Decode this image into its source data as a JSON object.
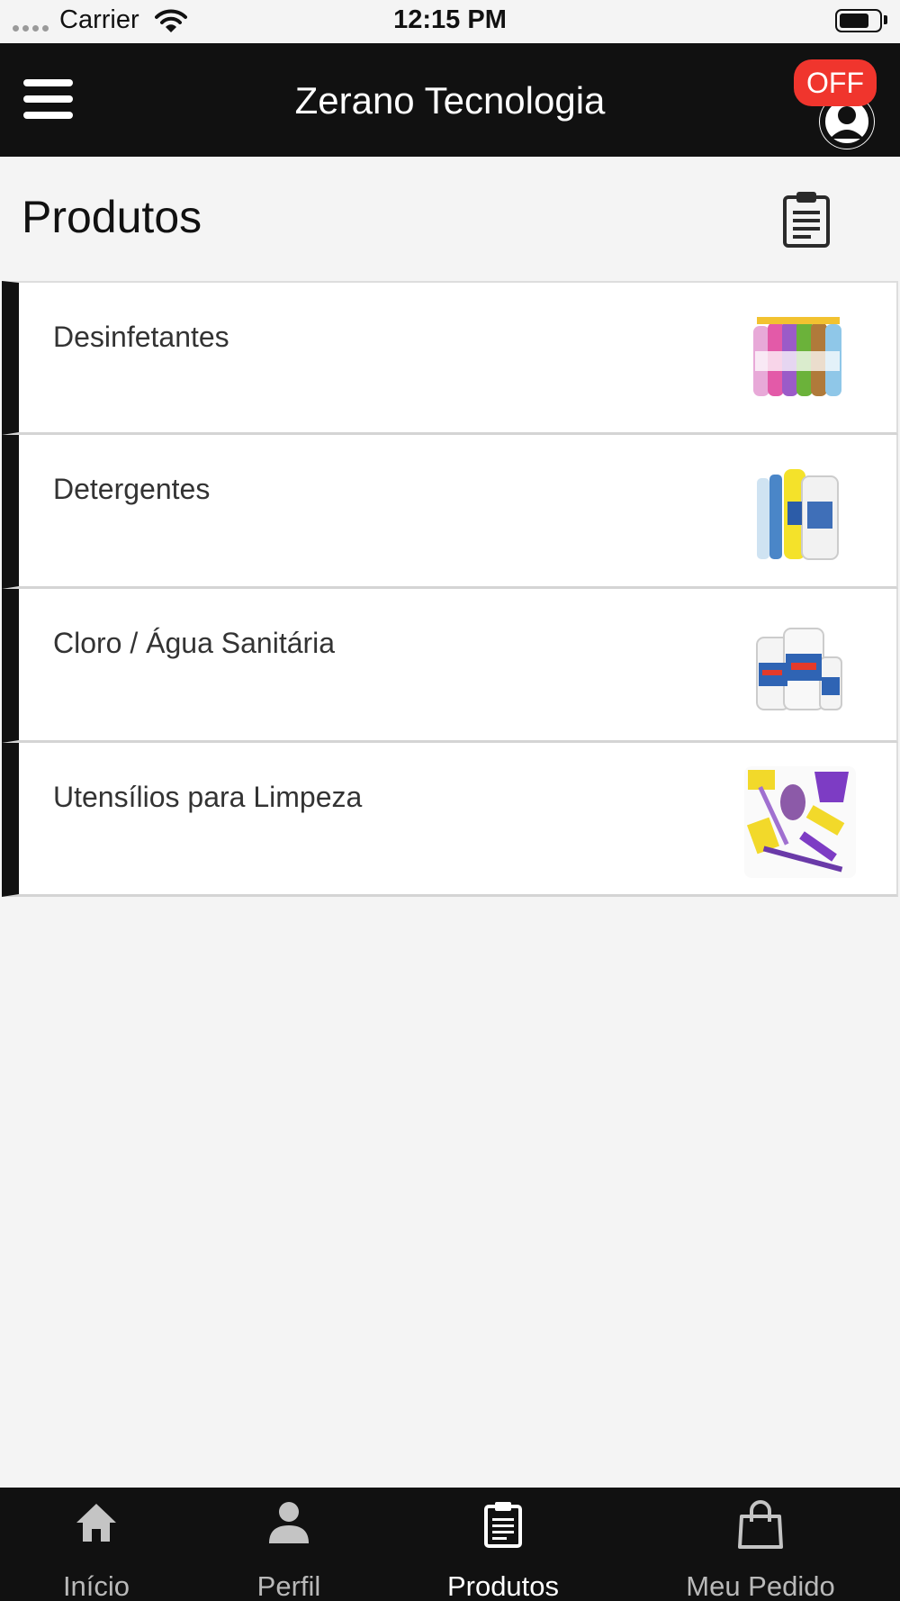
{
  "status_bar": {
    "carrier": "Carrier",
    "time": "12:15 PM"
  },
  "header": {
    "title": "Zerano Tecnologia",
    "status_badge": "OFF"
  },
  "page": {
    "title": "Produtos"
  },
  "categories": [
    {
      "label": "Desinfetantes",
      "image": "disinfectant-bottles"
    },
    {
      "label": "Detergentes",
      "image": "detergent-bottles"
    },
    {
      "label": "Cloro / Água Sanitária",
      "image": "bleach-bottles"
    },
    {
      "label": "Utensílios para Limpeza",
      "image": "cleaning-utensils"
    }
  ],
  "tabs": [
    {
      "label": "Início",
      "icon": "home-icon",
      "active": false
    },
    {
      "label": "Perfil",
      "icon": "person-icon",
      "active": false
    },
    {
      "label": "Produtos",
      "icon": "clipboard-icon",
      "active": true
    },
    {
      "label": "Meu Pedido",
      "icon": "shopping-bag-icon",
      "active": false
    }
  ],
  "colors": {
    "header_bg": "#111111",
    "badge": "#f0352d",
    "accent_bar": "#111111",
    "page_bg": "#f4f4f4"
  }
}
